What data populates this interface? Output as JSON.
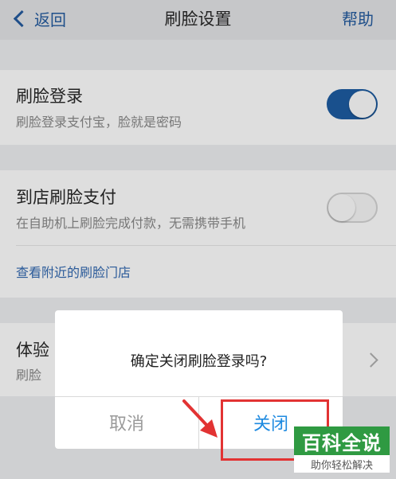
{
  "navbar": {
    "back_label": "返回",
    "title": "刷脸设置",
    "help_label": "帮助"
  },
  "face_login": {
    "title": "刷脸登录",
    "subtitle": "刷脸登录支付宝，脸就是密码",
    "toggle_on": true
  },
  "in_store": {
    "title": "到店刷脸支付",
    "subtitle": "在自助机上刷脸完成付款，无需携带手机",
    "toggle_on": false,
    "nearby_link": "查看附近的刷脸门店"
  },
  "experience": {
    "title_partial": "体验",
    "subtitle_partial": "刷脸"
  },
  "dialog": {
    "message": "确定关闭刷脸登录吗?",
    "cancel_label": "取消",
    "confirm_label": "关闭"
  },
  "watermark": {
    "brand": "百科全说",
    "tagline": "助你轻松解决"
  },
  "colors": {
    "accent_blue": "#1e8ae0",
    "annotation_red": "#e23333",
    "watermark_green": "#2f9a42"
  }
}
